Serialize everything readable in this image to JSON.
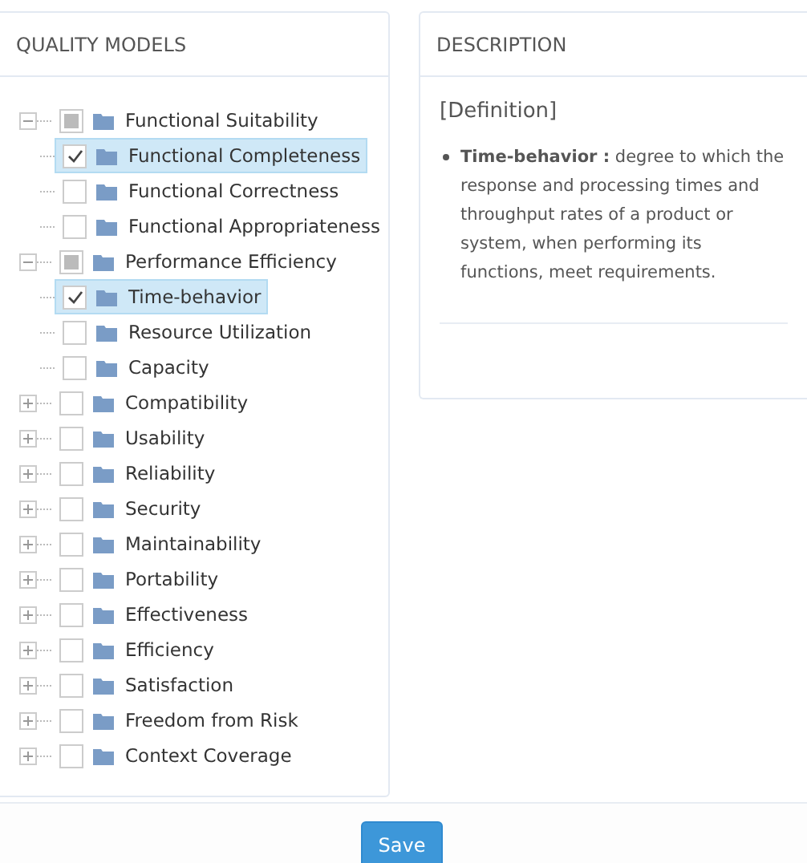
{
  "models_panel": {
    "title": "QUALITY MODELS",
    "tree": [
      {
        "label": "Functional Suitability",
        "expanded": true,
        "checked": false,
        "partial": true,
        "selected": false,
        "children": [
          {
            "label": "Functional Completeness",
            "checked": true,
            "selected": true
          },
          {
            "label": "Functional Correctness",
            "checked": false,
            "selected": false
          },
          {
            "label": "Functional Appropriateness",
            "checked": false,
            "selected": false
          }
        ]
      },
      {
        "label": "Performance Efficiency",
        "expanded": true,
        "checked": false,
        "partial": true,
        "selected": false,
        "children": [
          {
            "label": "Time-behavior",
            "checked": true,
            "selected": true
          },
          {
            "label": "Resource Utilization",
            "checked": false,
            "selected": false
          },
          {
            "label": "Capacity",
            "checked": false,
            "selected": false
          }
        ]
      },
      {
        "label": "Compatibility",
        "expanded": false,
        "checked": false,
        "partial": false,
        "selected": false
      },
      {
        "label": "Usability",
        "expanded": false,
        "checked": false,
        "partial": false,
        "selected": false
      },
      {
        "label": "Reliability",
        "expanded": false,
        "checked": false,
        "partial": false,
        "selected": false
      },
      {
        "label": "Security",
        "expanded": false,
        "checked": false,
        "partial": false,
        "selected": false
      },
      {
        "label": "Maintainability",
        "expanded": false,
        "checked": false,
        "partial": false,
        "selected": false
      },
      {
        "label": "Portability",
        "expanded": false,
        "checked": false,
        "partial": false,
        "selected": false
      },
      {
        "label": "Effectiveness",
        "expanded": false,
        "checked": false,
        "partial": false,
        "selected": false
      },
      {
        "label": "Efficiency",
        "expanded": false,
        "checked": false,
        "partial": false,
        "selected": false
      },
      {
        "label": "Satisfaction",
        "expanded": false,
        "checked": false,
        "partial": false,
        "selected": false
      },
      {
        "label": "Freedom from Risk",
        "expanded": false,
        "checked": false,
        "partial": false,
        "selected": false
      },
      {
        "label": "Context Coverage",
        "expanded": false,
        "checked": false,
        "partial": false,
        "selected": false
      }
    ]
  },
  "description_panel": {
    "title": "DESCRIPTION",
    "heading": "[Definition]",
    "items": [
      "**Time-behavior :** degree to which the response and processing times and throughput rates of a product or system, when performing its functions, meet requirements."
    ]
  },
  "save_button": "Save"
}
